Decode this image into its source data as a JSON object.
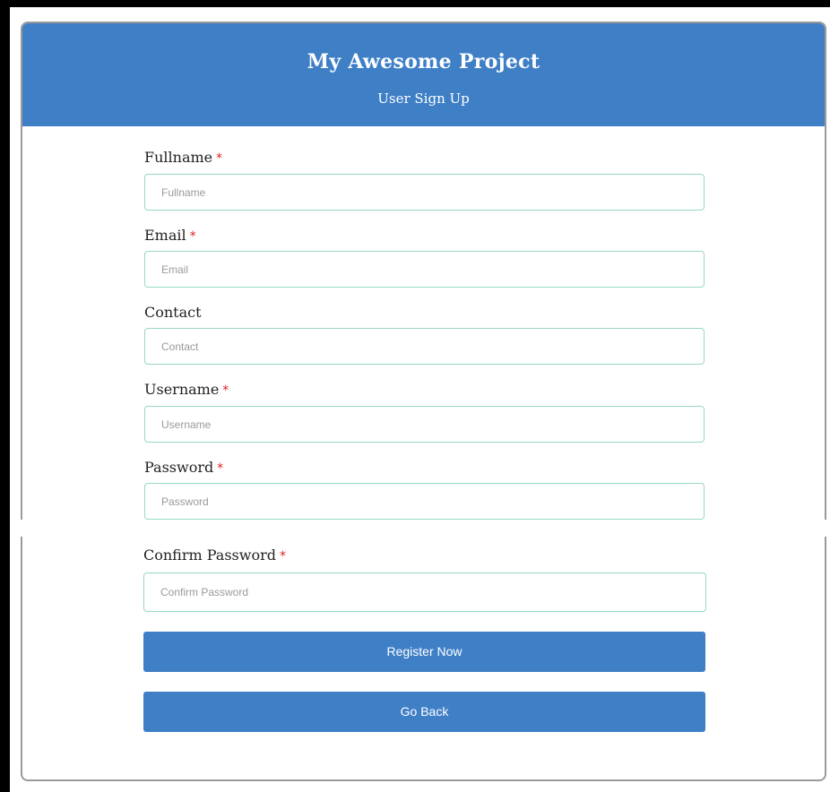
{
  "header": {
    "title": "My Awesome Project",
    "subtitle": "User Sign Up"
  },
  "form": {
    "fields": [
      {
        "label": "Fullname",
        "required": true,
        "placeholder": "Fullname",
        "value": ""
      },
      {
        "label": "Email",
        "required": true,
        "placeholder": "Email",
        "value": ""
      },
      {
        "label": "Contact",
        "required": false,
        "placeholder": "Contact",
        "value": ""
      },
      {
        "label": "Username",
        "required": true,
        "placeholder": "Username",
        "value": ""
      },
      {
        "label": "Password",
        "required": true,
        "placeholder": "Password",
        "value": ""
      },
      {
        "label": "Confirm Password",
        "required": true,
        "placeholder": "Confirm Password",
        "value": ""
      }
    ],
    "required_mark": "*",
    "register_label": "Register Now",
    "back_label": "Go Back"
  },
  "colors": {
    "header_bg": "#3f7fc6",
    "button_bg": "#3f7fc6",
    "input_border": "#98d8c3",
    "required_mark": "#e02020"
  }
}
